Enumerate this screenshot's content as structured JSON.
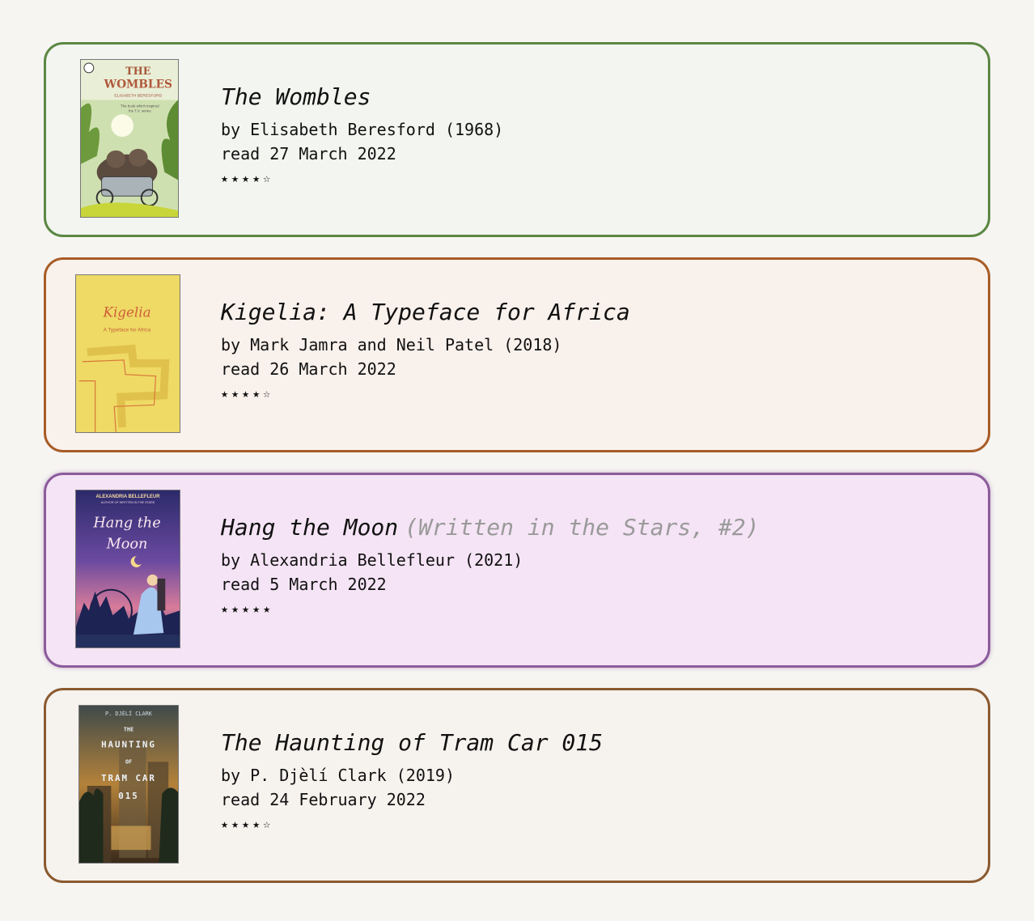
{
  "books": [
    {
      "title": "The Wombles",
      "series": "",
      "byline": "by Elisabeth Beresford (1968)",
      "read": "read 27 March 2022",
      "stars": "★★★★☆",
      "rating": 4,
      "accent": "#5b8742",
      "cover": {
        "title_lines": [
          "THE",
          "WOMBLES"
        ],
        "author": "ELISABETH BERESFORD",
        "tagline": [
          "The book which inspired",
          "the T.V. series"
        ]
      }
    },
    {
      "title": "Kigelia: A Typeface for Africa",
      "series": "",
      "byline": "by Mark Jamra and Neil Patel (2018)",
      "read": "read 26 March 2022",
      "stars": "★★★★☆",
      "rating": 4,
      "accent": "#a85c26",
      "cover": {
        "title_lines": [
          "Kigelia"
        ],
        "subtitle": "A Typeface for Africa"
      }
    },
    {
      "title": "Hang the Moon",
      "series": "(Written in the Stars, #2)",
      "byline": "by Alexandria Bellefleur (2021)",
      "read": "read 5 March 2022",
      "stars": "★★★★★",
      "rating": 5,
      "accent": "#8c5b9c",
      "cover": {
        "author": "ALEXANDRIA BELLEFLEUR",
        "author_note": "AUTHOR OF WRITTEN IN THE STARS",
        "title_lines": [
          "Hang the",
          "Moon"
        ]
      }
    },
    {
      "title": "The Haunting of Tram Car 015",
      "series": "",
      "byline": "by P. Djèlí Clark (2019)",
      "read": "read 24 February 2022",
      "stars": "★★★★☆",
      "rating": 4,
      "accent": "#8b5a2f",
      "cover": {
        "author": "P. DJÈLÍ CLARK",
        "title_lines": [
          "THE",
          "HAUNTING",
          "OF",
          "TRAM CAR",
          "015"
        ]
      }
    }
  ]
}
